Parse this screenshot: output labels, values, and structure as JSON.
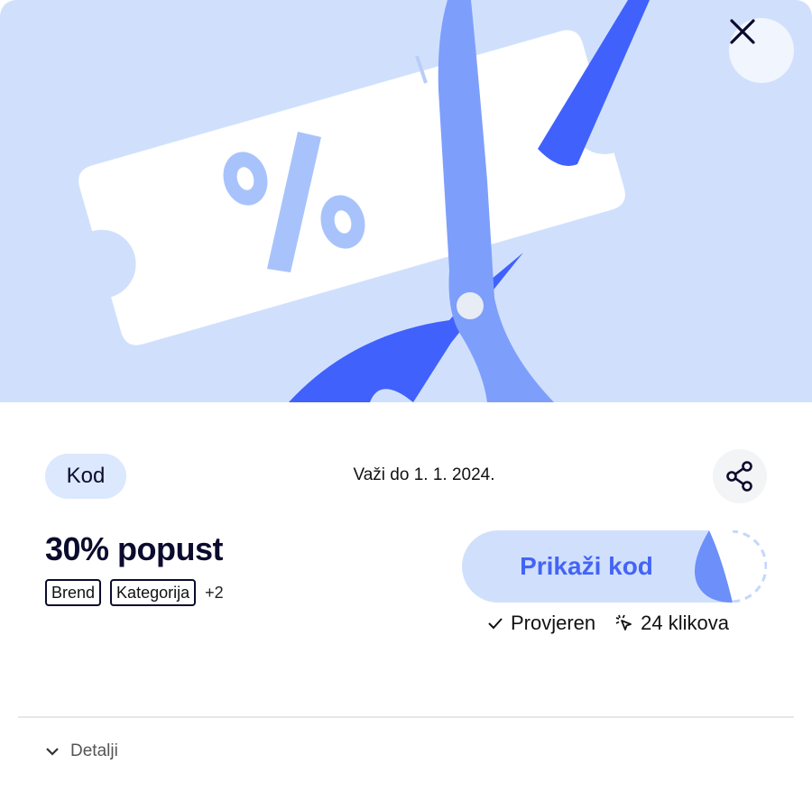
{
  "hero": {
    "illustration": "coupon-scissors",
    "symbol": "%"
  },
  "header": {
    "close_icon": "close-icon"
  },
  "coupon": {
    "type_badge": "Kod",
    "valid_until": "Važi do 1. 1. 2024.",
    "title": "30% popust",
    "tags": [
      "Brend",
      "Kategorija"
    ],
    "more_tags": "+2",
    "reveal_button": "Prikaži kod",
    "verified": "Provjeren",
    "clicks": "24 klikova"
  },
  "details": {
    "label": "Detalji"
  },
  "colors": {
    "hero_bg": "#d0e0fc",
    "accent": "#4464f6",
    "scissors_light": "#7d9ffb",
    "scissors_dark": "#4161fd",
    "text_dark": "#0b0b2e"
  }
}
